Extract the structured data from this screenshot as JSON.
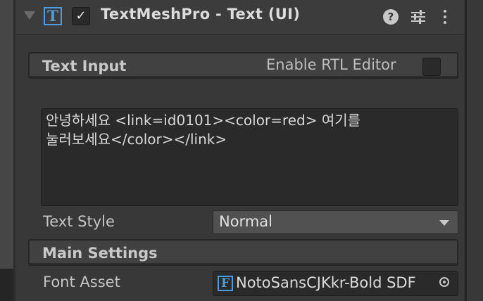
{
  "component": {
    "title": "TextMeshPro - Text (UI)",
    "enabled": true,
    "icon": "tmp-text-icon",
    "icon_glyph": "T"
  },
  "text_input": {
    "section_title": "Text Input",
    "rtl_label": "Enable RTL Editor",
    "rtl_enabled": false,
    "value": "안녕하세요 <link=id0101><color=red> 여기를\n눌러보세요</color></link>"
  },
  "text_style": {
    "label": "Text Style",
    "value": "Normal"
  },
  "main_settings": {
    "section_title": "Main Settings"
  },
  "font_asset": {
    "label": "Font Asset",
    "icon_glyph": "F",
    "value": "NotoSansCJKkr-Bold SDF"
  },
  "colors": {
    "accent": "#4a9de0",
    "panel": "#383838",
    "field": "#2a2a2a"
  }
}
